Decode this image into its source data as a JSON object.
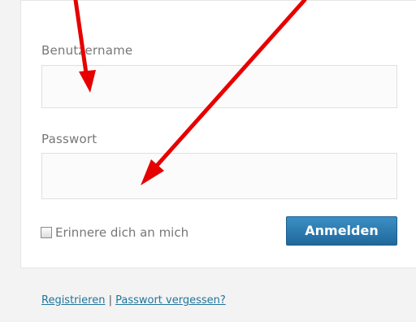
{
  "login_form": {
    "username_label": "Benutzername",
    "username_value": "",
    "password_label": "Passwort",
    "password_value": "",
    "remember_label": "Erinnere dich an mich",
    "remember_checked": false,
    "submit_label": "Anmelden"
  },
  "footer": {
    "register_link": "Registrieren",
    "separator": "|",
    "lost_password_link": "Passwort vergessen?"
  },
  "colors": {
    "page_background": "#f3f3f3",
    "panel_background": "#ffffff",
    "button_background": "#2a7ab0",
    "link_color": "#21759b",
    "annotation_arrow": "#e60000"
  }
}
